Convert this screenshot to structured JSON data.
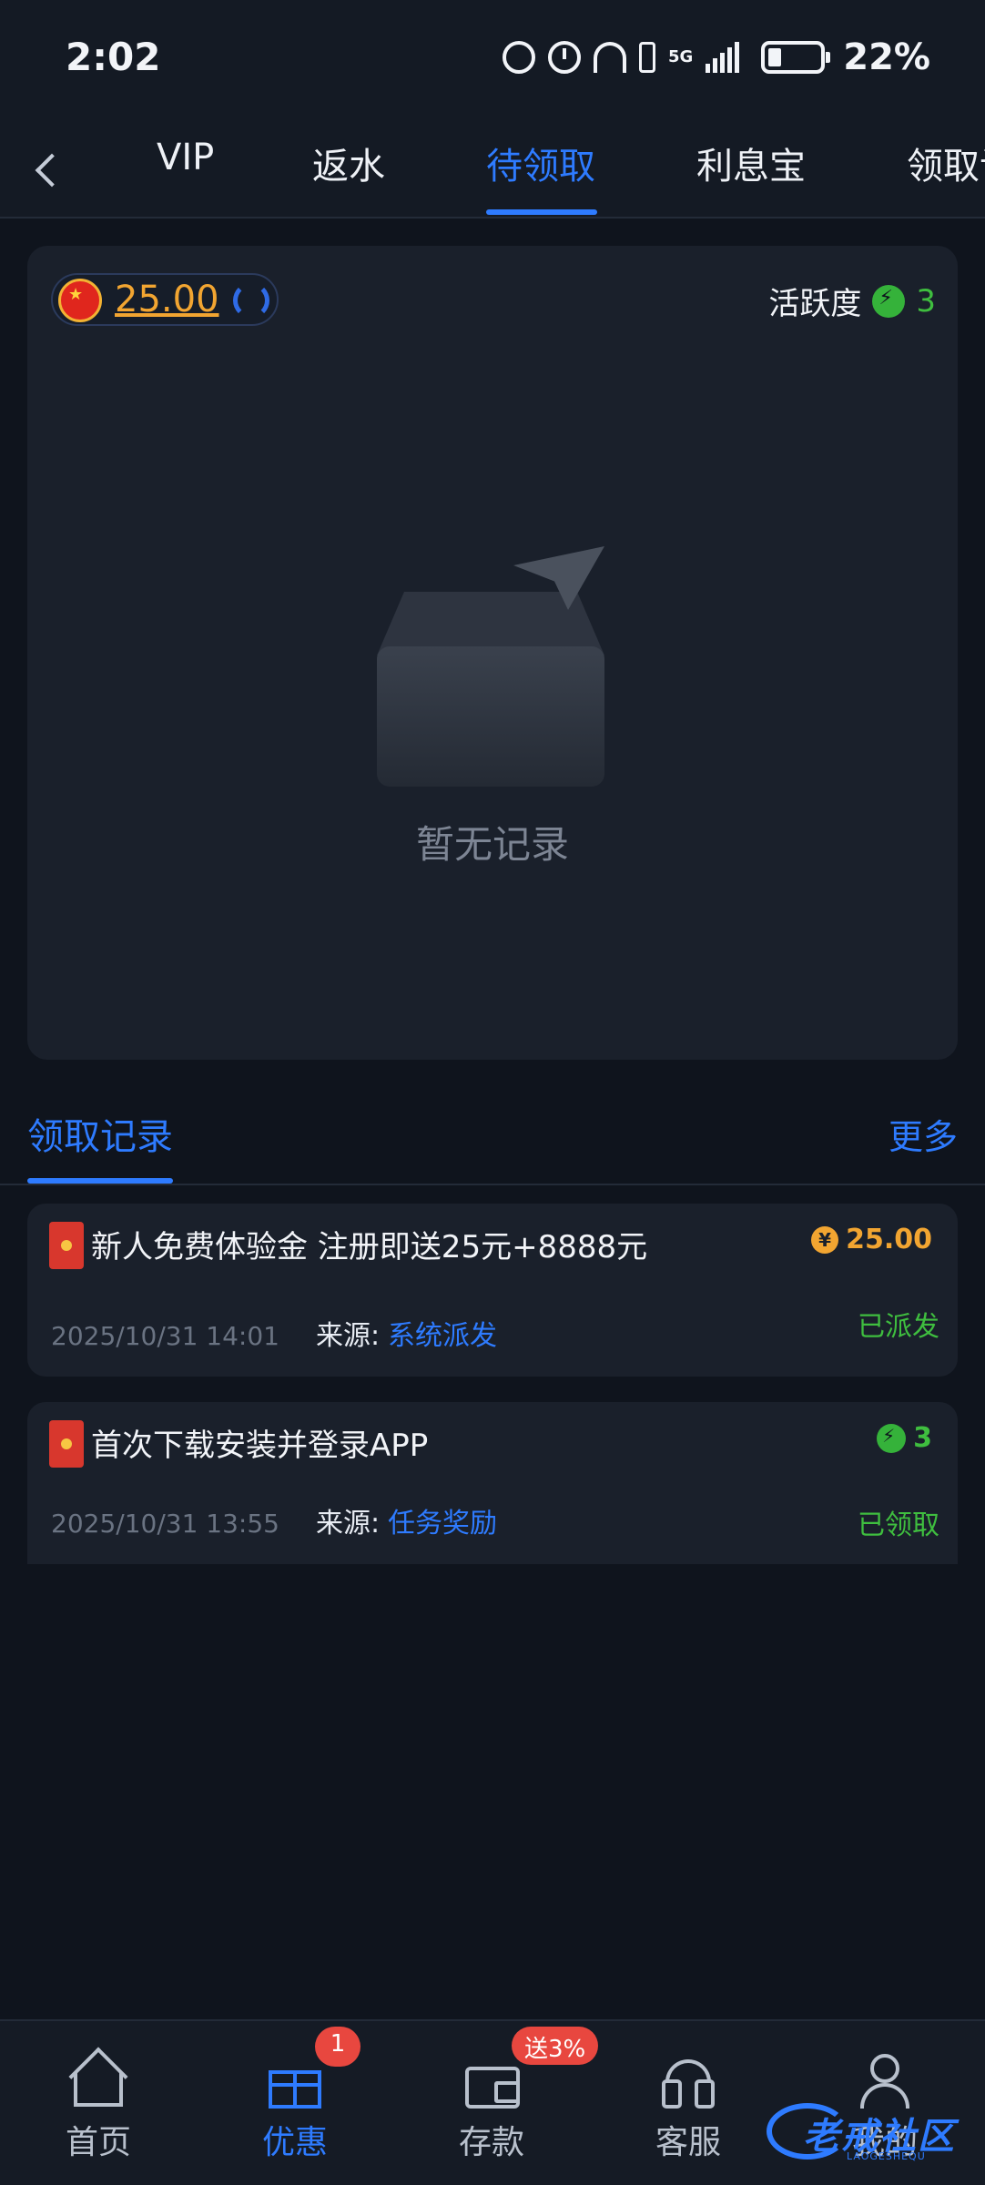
{
  "status_bar": {
    "time": "2:02",
    "battery": "22%",
    "network": "5G"
  },
  "tabs": [
    {
      "label": "VIP"
    },
    {
      "label": "返水"
    },
    {
      "label": "待领取"
    },
    {
      "label": "利息宝"
    },
    {
      "label": "领取记"
    }
  ],
  "active_tab": "待领取",
  "wallet": {
    "balance": "25.00",
    "activity_label": "活跃度",
    "activity_value": "3"
  },
  "empty_state": {
    "text": "暂无记录"
  },
  "records_section": {
    "title": "领取记录",
    "more": "更多"
  },
  "records": [
    {
      "title": "新人免费体验金 注册即送25元+8888元",
      "amount": "25.00",
      "amount_icon": "yuan-coin-icon",
      "status": "已派发",
      "time": "2025/10/31 14:01",
      "source_label": "来源:",
      "source": "系统派发"
    },
    {
      "title": "首次下载安装并登录APP",
      "amount": "3",
      "amount_icon": "bolt-icon",
      "status": "已领取",
      "time": "2025/10/31 13:55",
      "source_label": "来源:",
      "source": "任务奖励"
    }
  ],
  "bottom_nav": [
    {
      "label": "首页",
      "icon": "home-icon"
    },
    {
      "label": "优惠",
      "icon": "gift-icon",
      "badge": "1",
      "active": true
    },
    {
      "label": "存款",
      "icon": "wallet-icon",
      "badge": "送3%"
    },
    {
      "label": "客服",
      "icon": "headset-icon"
    },
    {
      "label": "我的",
      "icon": "person-icon"
    }
  ],
  "watermark": {
    "text": "老戒社区",
    "sub": "LAOGESHEQU"
  },
  "colors": {
    "accent": "#2e7bff",
    "gold": "#f2a531",
    "green": "#3fbe3f",
    "background": "#0f141d",
    "card": "#1a202b"
  }
}
